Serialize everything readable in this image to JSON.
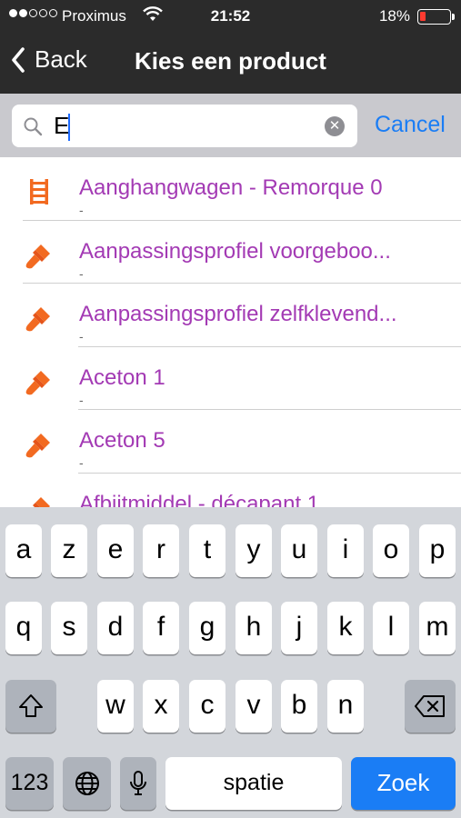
{
  "status": {
    "carrier": "Proximus",
    "time": "21:52",
    "battery": "18%"
  },
  "nav": {
    "back_label": "Back",
    "title": "Kies een product"
  },
  "search": {
    "value": "E",
    "cancel_label": "Cancel"
  },
  "items": [
    {
      "title": "Aanghangwagen - Remorque 0",
      "sub": "-",
      "icon": "ladder-icon"
    },
    {
      "title": "Aanpassingsprofiel voorgeboo...",
      "sub": "-",
      "icon": "paintbrush-icon"
    },
    {
      "title": "Aanpassingsprofiel zelfklevend...",
      "sub": "-",
      "icon": "paintbrush-icon"
    },
    {
      "title": "Aceton 1",
      "sub": "-",
      "icon": "paintbrush-icon"
    },
    {
      "title": "Aceton 5",
      "sub": "-",
      "icon": "paintbrush-icon"
    },
    {
      "title": "Afbijtmiddel - décapant 1",
      "sub": "-",
      "icon": "paintbrush-icon"
    }
  ],
  "keyboard": {
    "row1": [
      "a",
      "z",
      "e",
      "r",
      "t",
      "y",
      "u",
      "i",
      "o",
      "p"
    ],
    "row2": [
      "q",
      "s",
      "d",
      "f",
      "g",
      "h",
      "j",
      "k",
      "l",
      "m"
    ],
    "row3": [
      "w",
      "x",
      "c",
      "v",
      "b",
      "n"
    ],
    "numbers_label": "123",
    "space_label": "spatie",
    "return_label": "Zoek"
  },
  "colors": {
    "accent": "#1a7df5",
    "item_title": "#a33ab4",
    "icon_orange": "#f26a21"
  }
}
